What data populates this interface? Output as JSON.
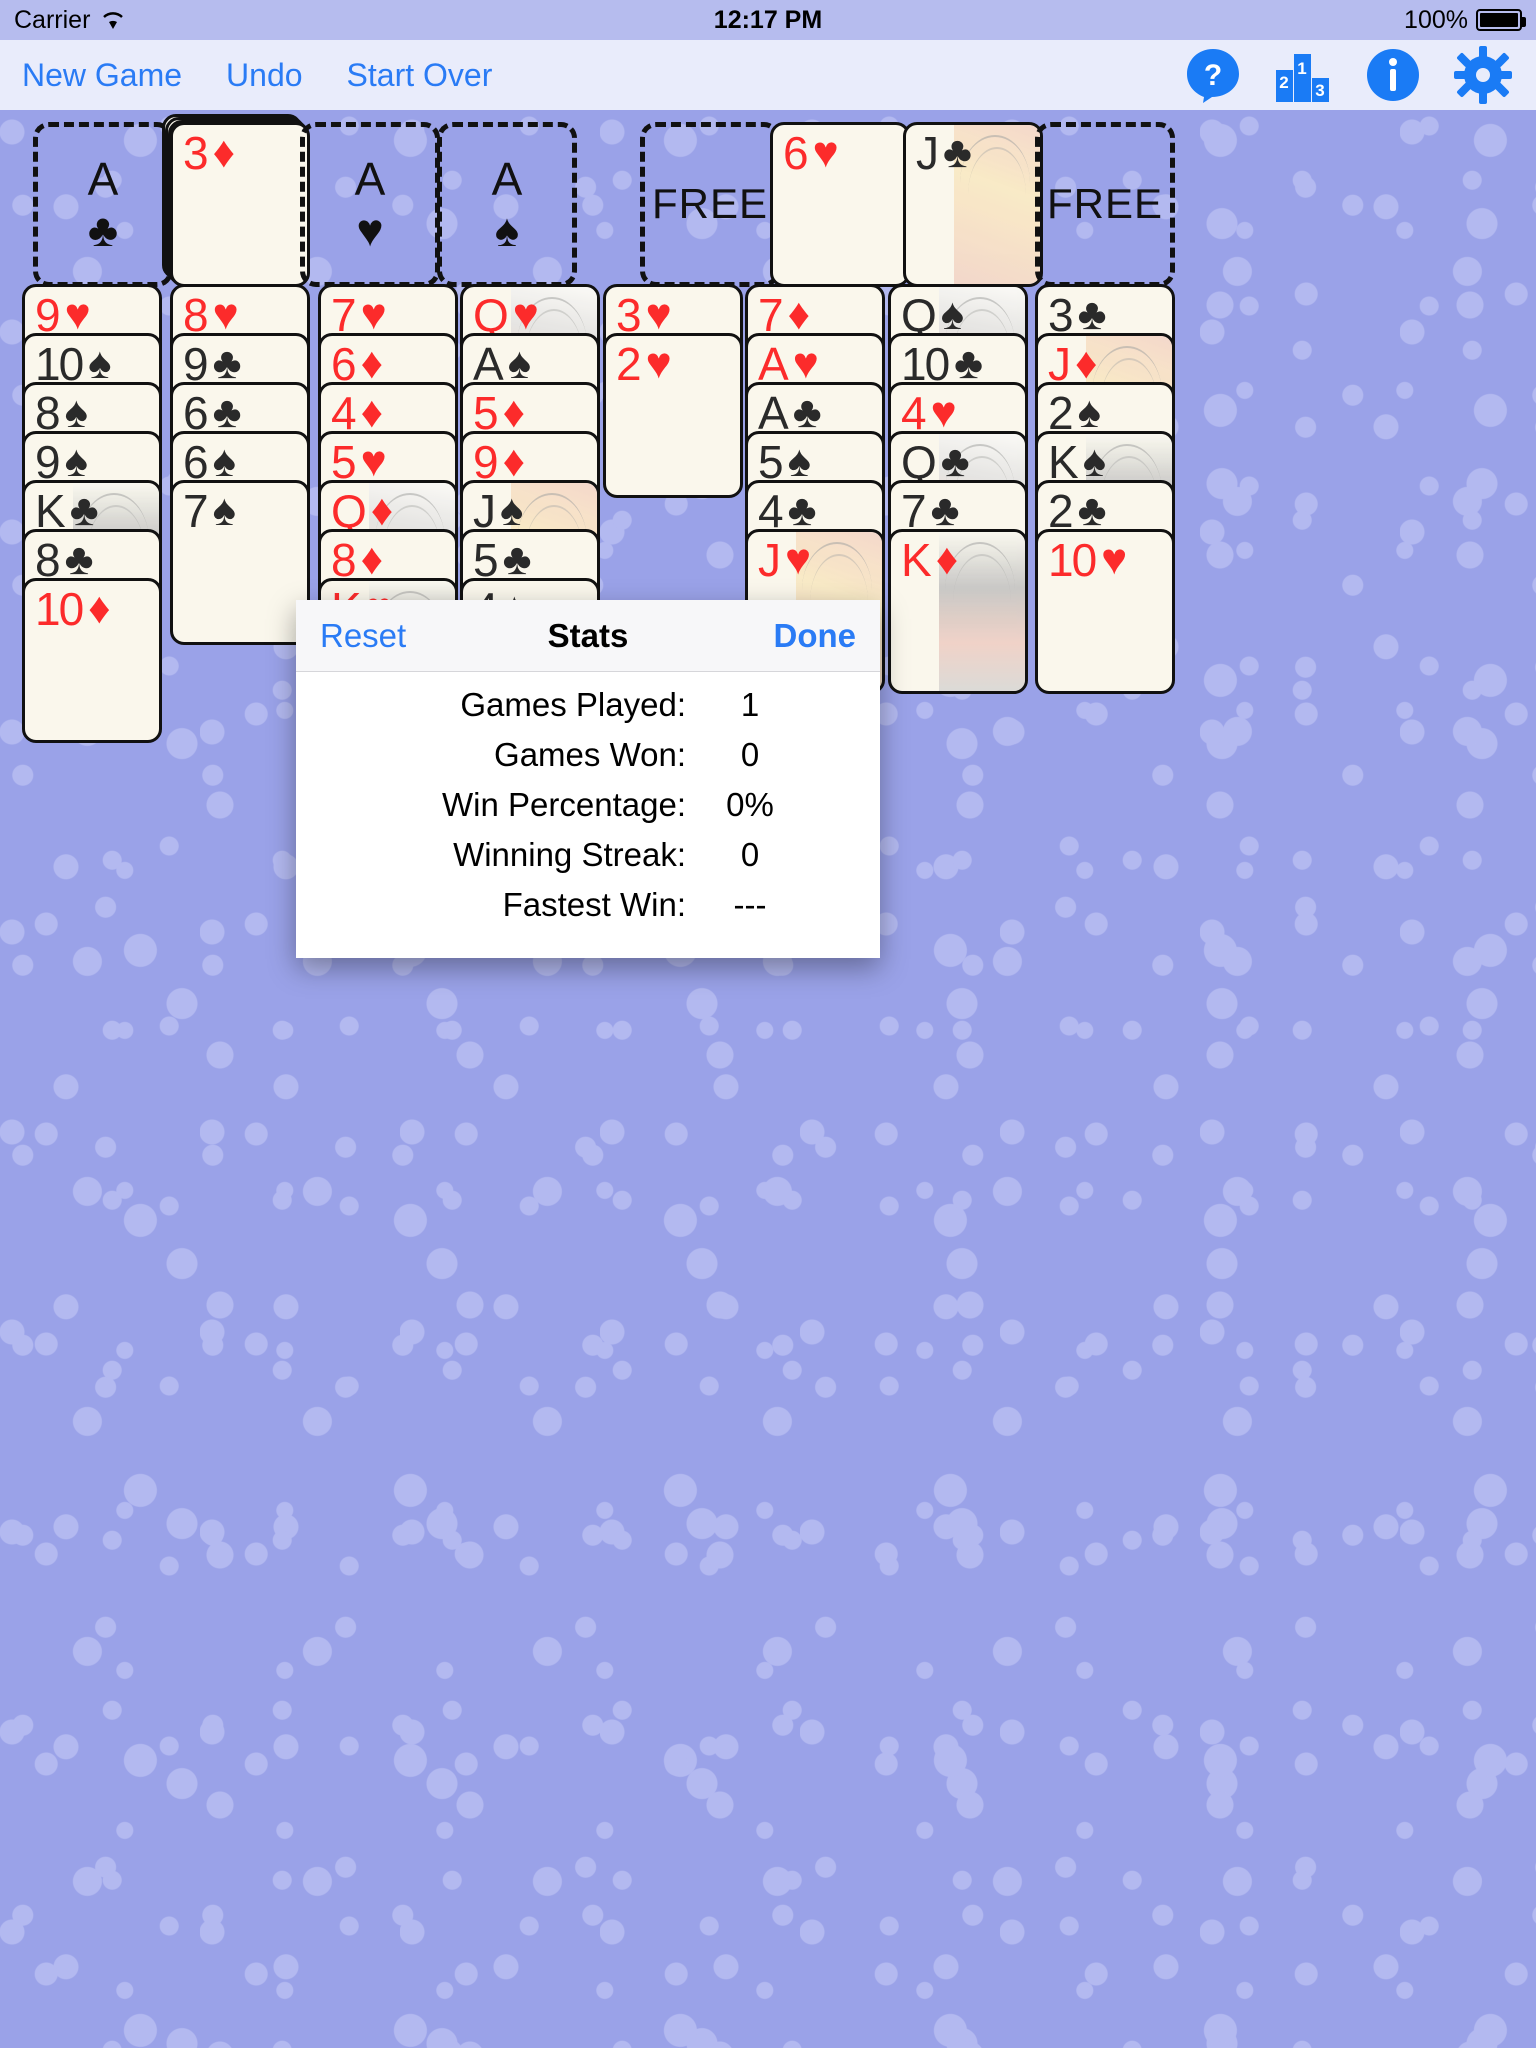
{
  "statusbar": {
    "carrier": "Carrier",
    "wifi_icon": "wifi-icon",
    "time": "12:17 PM",
    "battery_percent": "100%",
    "battery_icon": "battery-full-icon"
  },
  "toolbar": {
    "new_game": "New Game",
    "undo": "Undo",
    "start_over": "Start Over",
    "icons": [
      {
        "name": "help-icon",
        "label": "?"
      },
      {
        "name": "stats-podium-icon",
        "label": "213"
      },
      {
        "name": "info-icon",
        "label": "i"
      },
      {
        "name": "settings-gear-icon",
        "label": "gear"
      }
    ],
    "accent_color": "#2a7bf5"
  },
  "board": {
    "foundations": [
      {
        "type": "empty",
        "rank": "A",
        "suit": "♣",
        "color": "black",
        "name": "foundation-clubs"
      },
      {
        "type": "card",
        "rank": "3",
        "suit": "♦",
        "color": "red",
        "name": "foundation-diamonds"
      },
      {
        "type": "empty",
        "rank": "A",
        "suit": "♥",
        "color": "black",
        "name": "foundation-hearts"
      },
      {
        "type": "empty",
        "rank": "A",
        "suit": "♠",
        "color": "black",
        "name": "foundation-spades"
      }
    ],
    "freecells": [
      {
        "type": "empty",
        "label": "FREE",
        "name": "freecell-1"
      },
      {
        "type": "card",
        "rank": "6",
        "suit": "♥",
        "color": "red",
        "name": "freecell-2"
      },
      {
        "type": "card",
        "rank": "J",
        "suit": "♣",
        "color": "black",
        "face": "jack",
        "name": "freecell-3"
      },
      {
        "type": "empty",
        "label": "FREE",
        "name": "freecell-4"
      }
    ],
    "columns": [
      {
        "name": "tableau-column-1",
        "cards": [
          {
            "rank": "9",
            "suit": "♥",
            "color": "red"
          },
          {
            "rank": "10",
            "suit": "♠",
            "color": "black"
          },
          {
            "rank": "8",
            "suit": "♠",
            "color": "black"
          },
          {
            "rank": "9",
            "suit": "♠",
            "color": "black"
          },
          {
            "rank": "K",
            "suit": "♣",
            "color": "black",
            "face": "king"
          },
          {
            "rank": "8",
            "suit": "♣",
            "color": "black"
          },
          {
            "rank": "10",
            "suit": "♦",
            "color": "red"
          }
        ]
      },
      {
        "name": "tableau-column-2",
        "cards": [
          {
            "rank": "8",
            "suit": "♥",
            "color": "red"
          },
          {
            "rank": "9",
            "suit": "♣",
            "color": "black"
          },
          {
            "rank": "6",
            "suit": "♣",
            "color": "black"
          },
          {
            "rank": "6",
            "suit": "♠",
            "color": "black"
          },
          {
            "rank": "7",
            "suit": "♠",
            "color": "black"
          }
        ]
      },
      {
        "name": "tableau-column-3",
        "cards": [
          {
            "rank": "7",
            "suit": "♥",
            "color": "red"
          },
          {
            "rank": "6",
            "suit": "♦",
            "color": "red"
          },
          {
            "rank": "4",
            "suit": "♦",
            "color": "red"
          },
          {
            "rank": "5",
            "suit": "♥",
            "color": "red"
          },
          {
            "rank": "Q",
            "suit": "♦",
            "color": "red",
            "face": "queen"
          },
          {
            "rank": "8",
            "suit": "♦",
            "color": "red"
          },
          {
            "rank": "K",
            "suit": "♥",
            "color": "red",
            "face": "king"
          }
        ]
      },
      {
        "name": "tableau-column-4",
        "cards": [
          {
            "rank": "Q",
            "suit": "♥",
            "color": "red",
            "face": "queen"
          },
          {
            "rank": "A",
            "suit": "♠",
            "color": "black"
          },
          {
            "rank": "5",
            "suit": "♦",
            "color": "red"
          },
          {
            "rank": "9",
            "suit": "♦",
            "color": "red"
          },
          {
            "rank": "J",
            "suit": "♠",
            "color": "black",
            "face": "jack"
          },
          {
            "rank": "5",
            "suit": "♣",
            "color": "black"
          },
          {
            "rank": "4",
            "suit": "♠",
            "color": "black"
          }
        ]
      },
      {
        "name": "tableau-column-5",
        "cards": [
          {
            "rank": "3",
            "suit": "♥",
            "color": "red"
          },
          {
            "rank": "2",
            "suit": "♥",
            "color": "red"
          }
        ]
      },
      {
        "name": "tableau-column-6",
        "cards": [
          {
            "rank": "7",
            "suit": "♦",
            "color": "red"
          },
          {
            "rank": "A",
            "suit": "♥",
            "color": "red"
          },
          {
            "rank": "A",
            "suit": "♣",
            "color": "black"
          },
          {
            "rank": "5",
            "suit": "♠",
            "color": "black"
          },
          {
            "rank": "4",
            "suit": "♣",
            "color": "black"
          },
          {
            "rank": "J",
            "suit": "♥",
            "color": "red",
            "face": "jack"
          }
        ]
      },
      {
        "name": "tableau-column-7",
        "cards": [
          {
            "rank": "Q",
            "suit": "♠",
            "color": "black",
            "face": "queen"
          },
          {
            "rank": "10",
            "suit": "♣",
            "color": "black"
          },
          {
            "rank": "4",
            "suit": "♥",
            "color": "red"
          },
          {
            "rank": "Q",
            "suit": "♣",
            "color": "black",
            "face": "queen"
          },
          {
            "rank": "7",
            "suit": "♣",
            "color": "black"
          },
          {
            "rank": "K",
            "suit": "♦",
            "color": "red",
            "face": "king"
          }
        ]
      },
      {
        "name": "tableau-column-8",
        "cards": [
          {
            "rank": "3",
            "suit": "♣",
            "color": "black"
          },
          {
            "rank": "J",
            "suit": "♦",
            "color": "red",
            "face": "jack"
          },
          {
            "rank": "2",
            "suit": "♠",
            "color": "black"
          },
          {
            "rank": "K",
            "suit": "♠",
            "color": "black",
            "face": "king"
          },
          {
            "rank": "2",
            "suit": "♣",
            "color": "black"
          },
          {
            "rank": "10",
            "suit": "♥",
            "color": "red"
          }
        ]
      }
    ]
  },
  "dialog": {
    "reset_label": "Reset",
    "title": "Stats",
    "done_label": "Done",
    "rows": [
      {
        "label": "Games Played:",
        "value": "1"
      },
      {
        "label": "Games Won:",
        "value": "0"
      },
      {
        "label": "Win Percentage:",
        "value": "0%"
      },
      {
        "label": "Winning Streak:",
        "value": "0"
      },
      {
        "label": "Fastest Win:",
        "value": "---"
      }
    ]
  }
}
